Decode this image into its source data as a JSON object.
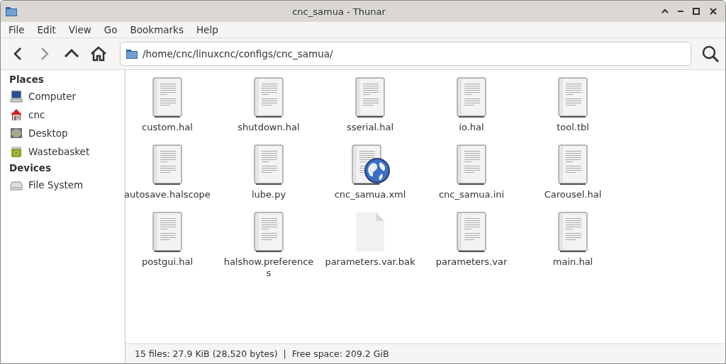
{
  "window": {
    "title": "cnc_samua - Thunar"
  },
  "menu": [
    "File",
    "Edit",
    "View",
    "Go",
    "Bookmarks",
    "Help"
  ],
  "location": {
    "path": "/home/cnc/linuxcnc/configs/cnc_samua/"
  },
  "sidebar": {
    "sections": [
      {
        "title": "Places",
        "items": [
          {
            "label": "Computer",
            "kind": "computer"
          },
          {
            "label": "cnc",
            "kind": "home"
          },
          {
            "label": "Desktop",
            "kind": "desktop"
          },
          {
            "label": "Wastebasket",
            "kind": "trash"
          }
        ]
      },
      {
        "title": "Devices",
        "items": [
          {
            "label": "File System",
            "kind": "drive"
          }
        ]
      }
    ]
  },
  "files": [
    {
      "name": "custom.hal",
      "kind": "text"
    },
    {
      "name": "shutdown.hal",
      "kind": "text"
    },
    {
      "name": "sserial.hal",
      "kind": "text"
    },
    {
      "name": "io.hal",
      "kind": "text"
    },
    {
      "name": "tool.tbl",
      "kind": "text"
    },
    {
      "name": "autosave.halscope",
      "kind": "text"
    },
    {
      "name": "lube.py",
      "kind": "text"
    },
    {
      "name": "cnc_samua.xml",
      "kind": "xml"
    },
    {
      "name": "cnc_samua.ini",
      "kind": "text"
    },
    {
      "name": "Carousel.hal",
      "kind": "text"
    },
    {
      "name": "postgui.hal",
      "kind": "text"
    },
    {
      "name": "halshow.preferences",
      "kind": "text"
    },
    {
      "name": "parameters.var.bak",
      "kind": "blank"
    },
    {
      "name": "parameters.var",
      "kind": "text"
    },
    {
      "name": "main.hal",
      "kind": "text"
    }
  ],
  "status_bar": "15 files: 27.9 KiB (28,520 bytes)  |  Free space: 209.2 GiB"
}
